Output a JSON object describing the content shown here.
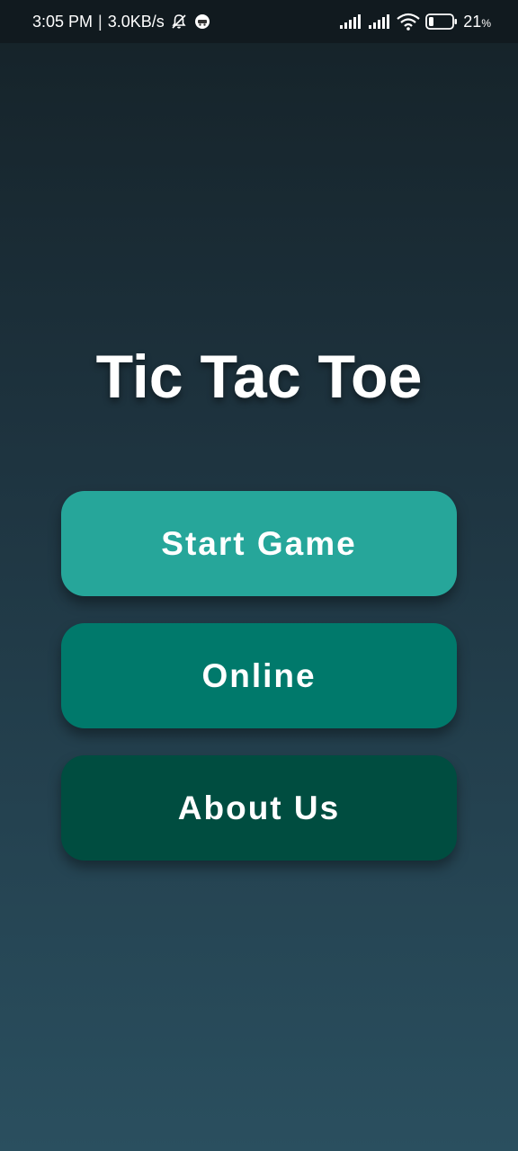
{
  "status_bar": {
    "time": "3:05 PM",
    "separator": "|",
    "network_speed": "3.0KB/s",
    "icons_left": [
      "bell-off-icon",
      "app-notification-icon"
    ],
    "icons_right": [
      "signal-sim1-icon",
      "signal-sim2-icon",
      "wifi-icon",
      "battery-icon"
    ],
    "battery_percent": "21",
    "battery_unit": "%",
    "battery_level": 0.21
  },
  "app": {
    "title": "Tic Tac Toe"
  },
  "menu": {
    "start_label": "Start Game",
    "online_label": "Online",
    "about_label": "About Us"
  },
  "colors": {
    "start_button": "#26a69a",
    "online_button": "#00796b",
    "about_button": "#004d40",
    "background_top": "#152228",
    "background_bottom": "#2a4f5f"
  }
}
